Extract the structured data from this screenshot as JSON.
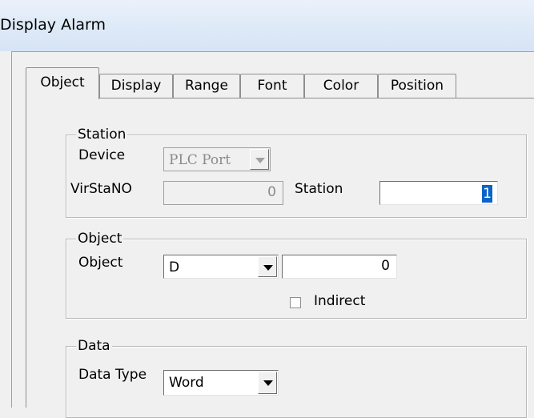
{
  "window": {
    "title": "Display Alarm"
  },
  "tabs": [
    {
      "label": "Object"
    },
    {
      "label": "Display"
    },
    {
      "label": "Range"
    },
    {
      "label": "Font"
    },
    {
      "label": "Color"
    },
    {
      "label": "Position"
    }
  ],
  "station": {
    "group_label": "Station",
    "device_label": "Device",
    "device_value": "PLC Port",
    "virstano_label": "VirStaNO",
    "virstano_value": "0",
    "station_label": "Station",
    "station_value": "1"
  },
  "object": {
    "group_label": "Object",
    "object_label": "Object",
    "object_type": "D",
    "object_address": "0",
    "indirect_label": "Indirect",
    "indirect_checked": false
  },
  "data": {
    "group_label": "Data",
    "data_type_label": "Data Type",
    "data_type_value": "Word"
  }
}
